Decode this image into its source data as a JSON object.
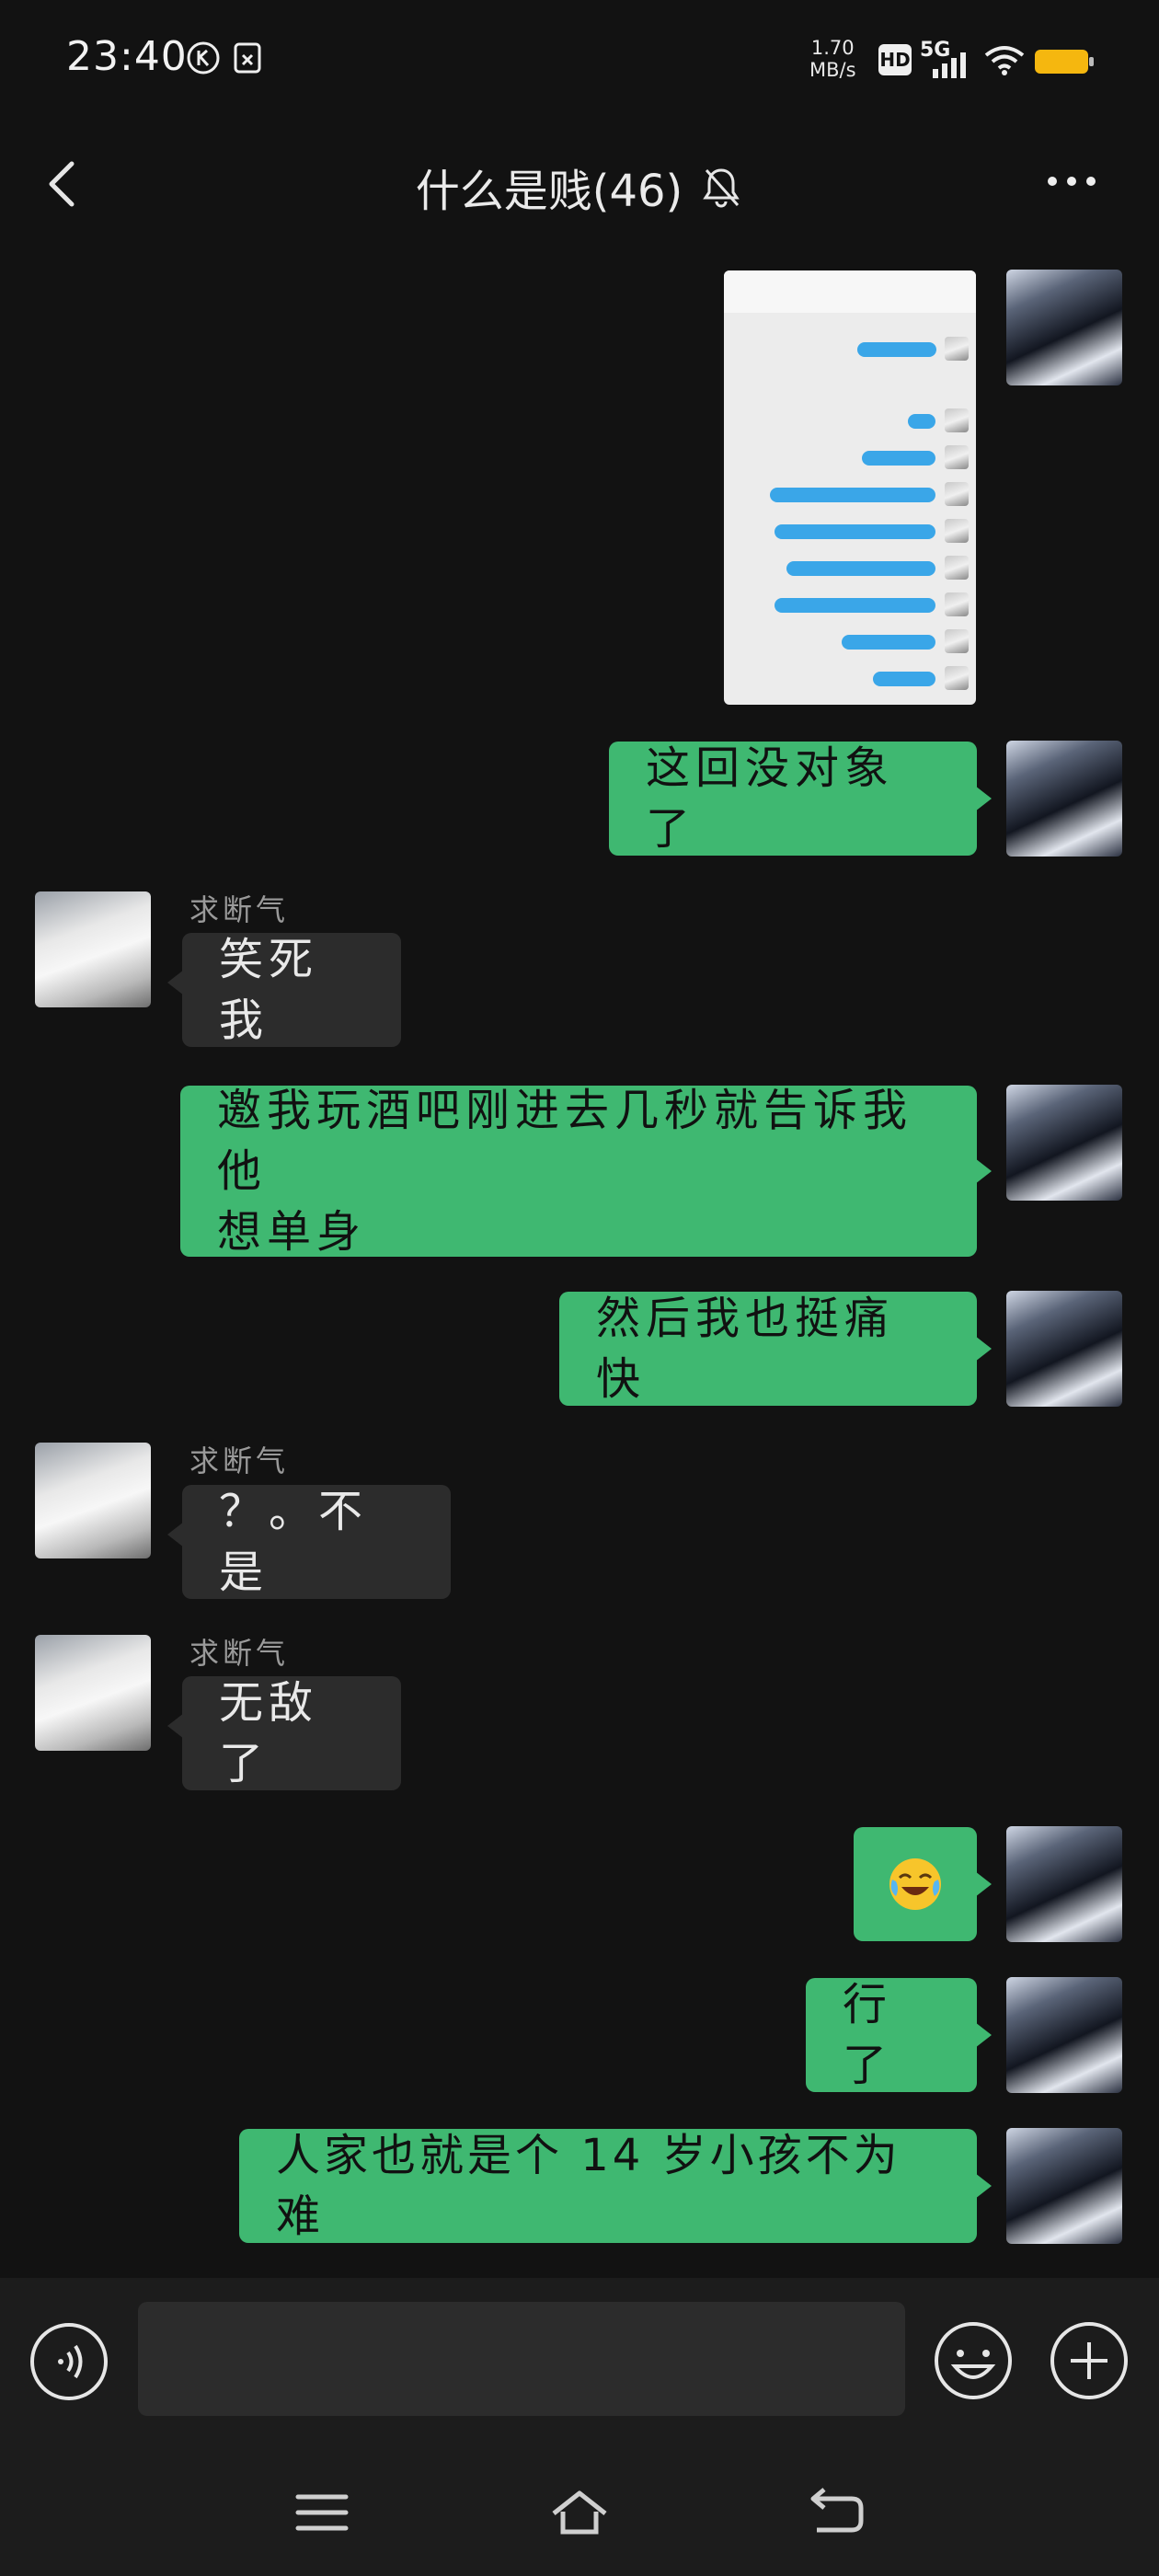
{
  "status_bar": {
    "time": "23:40",
    "net_speed_value": "1.70",
    "net_speed_unit": "MB/s",
    "hd": "HD",
    "network": "5G",
    "battery_color": "#f5b70f"
  },
  "header": {
    "title": "什么是贱(46)",
    "back_icon": "chevron-left-icon",
    "mute_icon": "bell-off-icon",
    "more_icon": "more-dots-icon"
  },
  "messages": [
    {
      "from": "me",
      "type": "image"
    },
    {
      "from": "me",
      "text": "这回没对象了"
    },
    {
      "from": "other",
      "sender": "求断气",
      "text": "笑死我"
    },
    {
      "from": "me",
      "text_line1": "邀我玩酒吧刚进去几秒就告诉我他",
      "text_line2": "想单身"
    },
    {
      "from": "me",
      "text": "然后我也挺痛快"
    },
    {
      "from": "other",
      "sender": "求断气",
      "text": "？。不是"
    },
    {
      "from": "other",
      "sender": "求断气",
      "text": "无敌了"
    },
    {
      "from": "me",
      "text": "😭"
    },
    {
      "from": "me",
      "text": "行了"
    },
    {
      "from": "me",
      "text": "人家也就是个 14 岁小孩不为难"
    }
  ],
  "input_bar": {
    "voice_icon": "voice-icon",
    "emoji_icon": "emoji-icon",
    "plus_icon": "plus-icon",
    "placeholder": ""
  },
  "nav_bar": {
    "icons": [
      "menu-icon",
      "home-icon",
      "back-icon"
    ]
  },
  "colors": {
    "background": "#121212",
    "my_bubble": "#3fb871",
    "their_bubble": "#2c2c2c"
  }
}
